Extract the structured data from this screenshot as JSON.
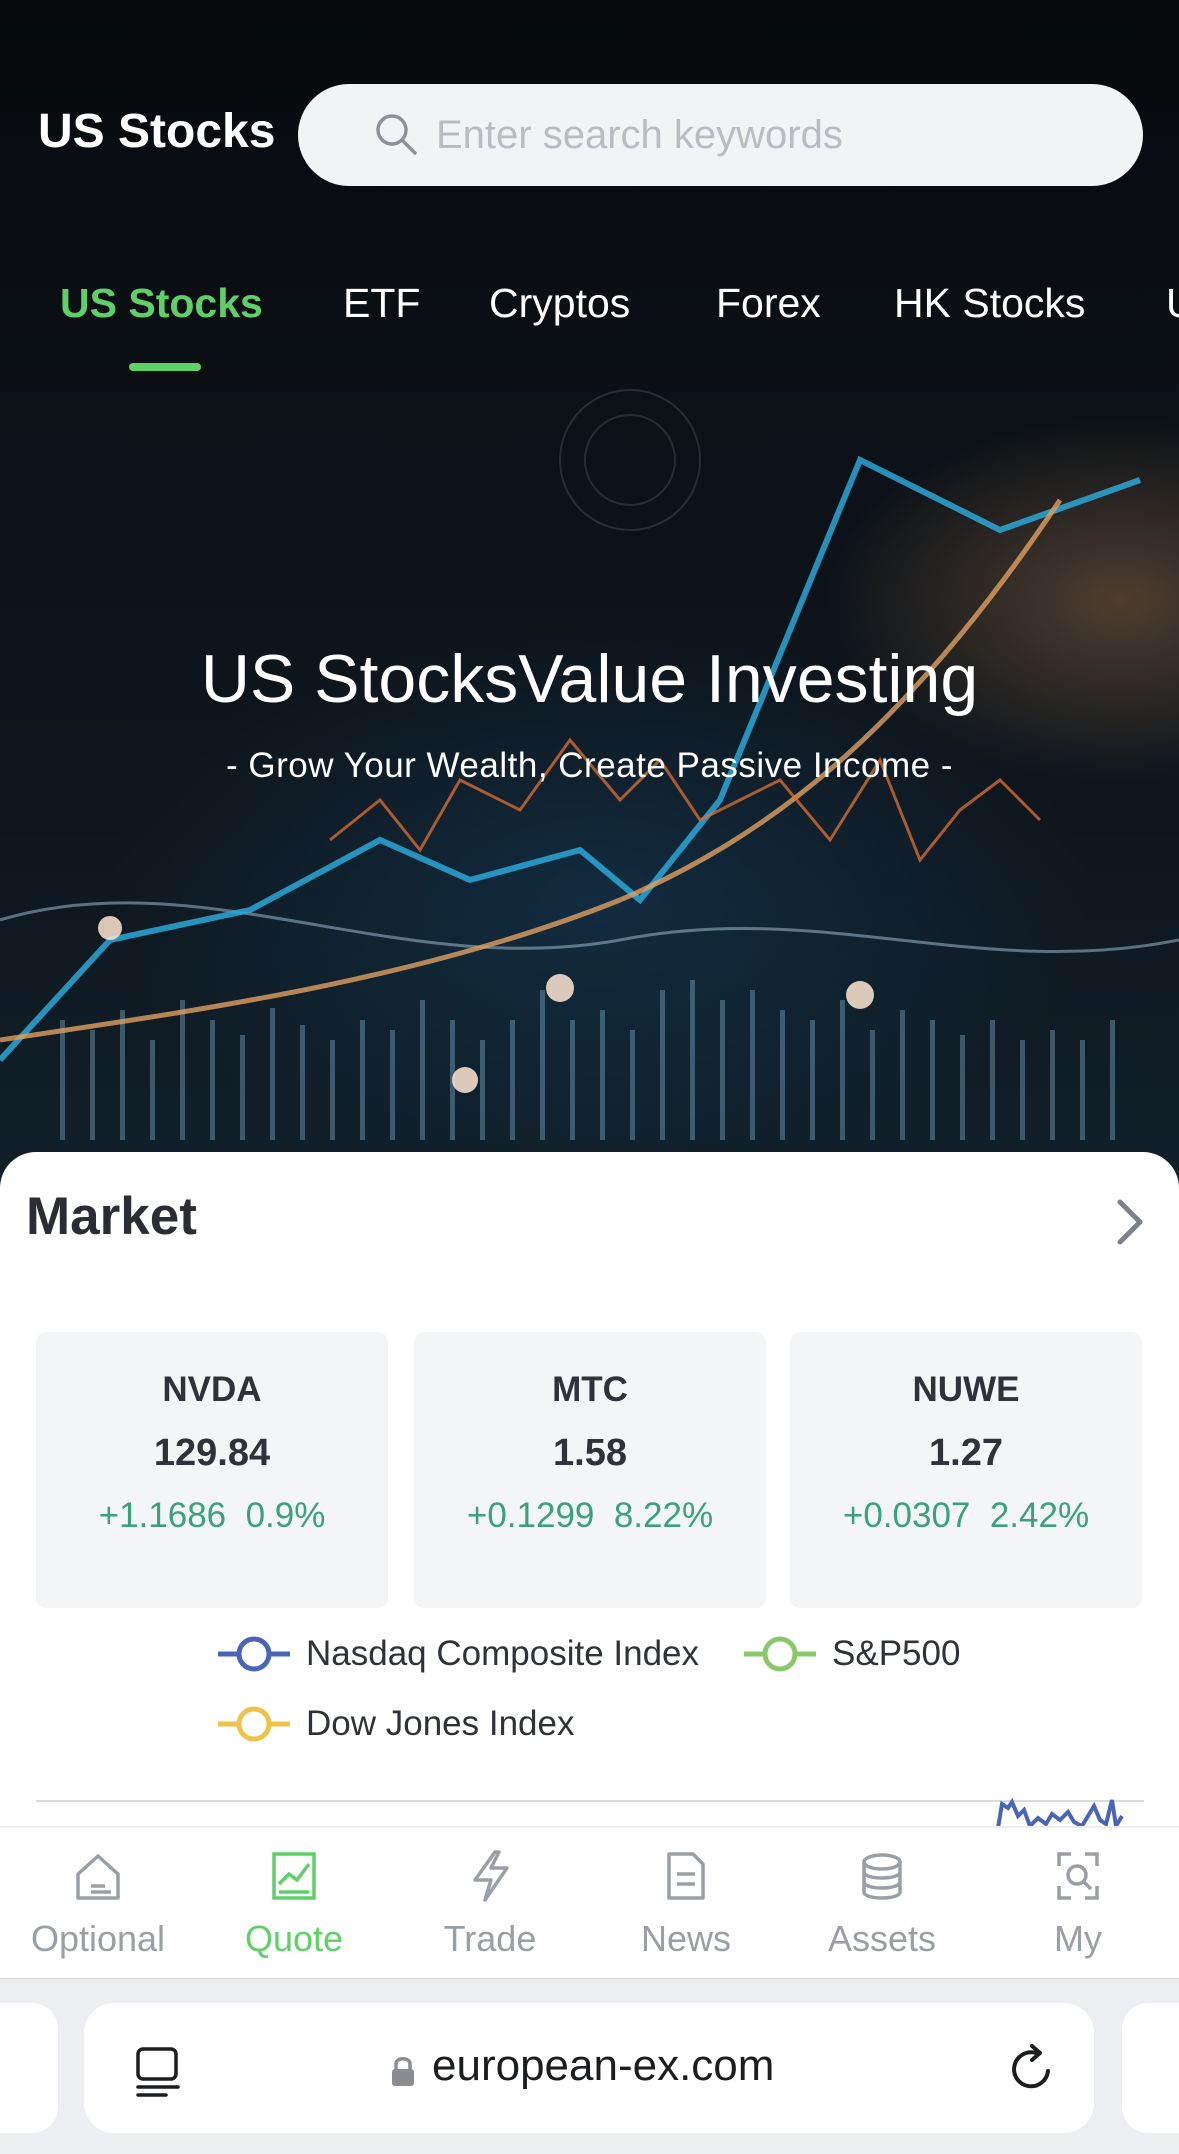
{
  "header": {
    "title": "US Stocks",
    "search_placeholder": "Enter search keywords"
  },
  "tabs": [
    {
      "label": "US Stocks",
      "active": true
    },
    {
      "label": "ETF",
      "active": false
    },
    {
      "label": "Cryptos",
      "active": false
    },
    {
      "label": "Forex",
      "active": false
    },
    {
      "label": "HK Stocks",
      "active": false
    },
    {
      "label": "U",
      "active": false
    }
  ],
  "banner": {
    "title": "US StocksValue Investing",
    "subtitle": "- Grow Your Wealth, Create Passive Income -"
  },
  "market": {
    "title": "Market",
    "quotes": [
      {
        "symbol": "NVDA",
        "price": "129.84",
        "change": "+1.1686  0.9%"
      },
      {
        "symbol": "MTC",
        "price": "1.58",
        "change": "+0.1299  8.22%"
      },
      {
        "symbol": "NUWE",
        "price": "1.27",
        "change": "+0.0307  2.42%"
      }
    ],
    "legend": [
      {
        "label": "Nasdaq Composite Index",
        "color": "#4a64b8"
      },
      {
        "label": "S&P500",
        "color": "#8bc86a"
      },
      {
        "label": "Dow Jones Index",
        "color": "#f0c24a"
      }
    ]
  },
  "nav": [
    {
      "label": "Optional",
      "icon": "home-icon",
      "active": false
    },
    {
      "label": "Quote",
      "icon": "chart-icon",
      "active": true
    },
    {
      "label": "Trade",
      "icon": "lightning-icon",
      "active": false
    },
    {
      "label": "News",
      "icon": "document-icon",
      "active": false
    },
    {
      "label": "Assets",
      "icon": "coins-icon",
      "active": false
    },
    {
      "label": "My",
      "icon": "profile-scan-icon",
      "active": false
    }
  ],
  "browser": {
    "url": "european-ex.com"
  },
  "colors": {
    "accent": "#5fd068",
    "positive": "#3aa17c"
  }
}
